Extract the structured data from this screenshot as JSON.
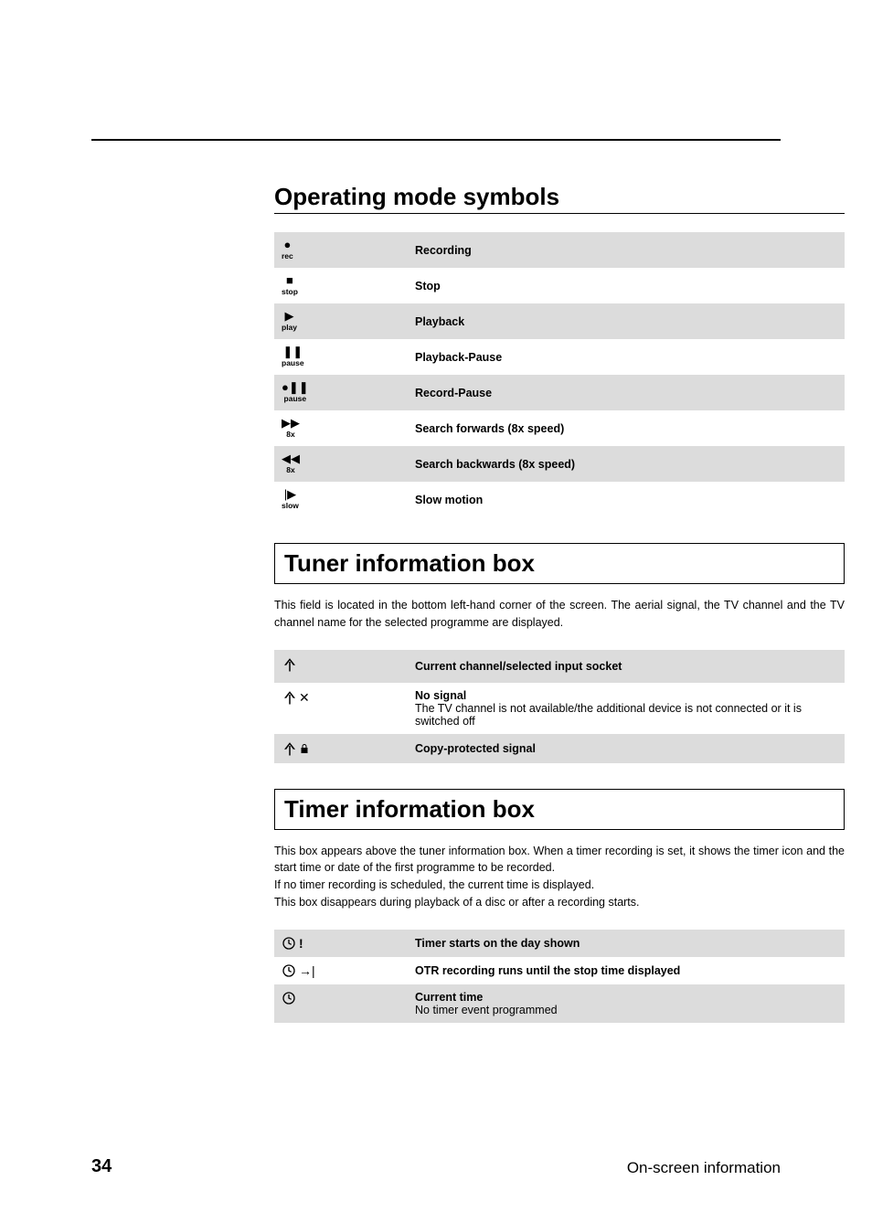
{
  "section1": {
    "heading": "Operating mode symbols",
    "rows": [
      {
        "glyph": "●",
        "label": "rec",
        "text": "Recording"
      },
      {
        "glyph": "■",
        "label": "stop",
        "text": "Stop"
      },
      {
        "glyph": "▶",
        "label": "play",
        "text": "Playback"
      },
      {
        "glyph": "❚❚",
        "label": "pause",
        "text": "Playback-Pause"
      },
      {
        "glyph": "●❚❚",
        "label": "pause",
        "text": "Record-Pause"
      },
      {
        "glyph": "▶▶",
        "label": "8x",
        "text": "Search forwards (8x speed)"
      },
      {
        "glyph": "◀◀",
        "label": "8x",
        "text": "Search backwards (8x speed)"
      },
      {
        "glyph": "|▶",
        "label": "slow",
        "text": "Slow motion"
      }
    ]
  },
  "section2": {
    "heading": "Tuner information box",
    "intro": "This field is located in the bottom left-hand corner of the screen. The aerial signal, the TV channel and the TV channel name for the selected programme are displayed.",
    "rows": [
      {
        "title": "Current channel/selected input socket",
        "sub": ""
      },
      {
        "title": "No signal",
        "sub": "The TV channel is not available/the additional device is not connected or it is switched off"
      },
      {
        "title": "Copy-protected signal",
        "sub": ""
      }
    ]
  },
  "section3": {
    "heading": "Timer information box",
    "intro1": "This box appears above the tuner information box. When a timer recording is set, it shows the timer icon and the start time or date of the first programme to be recorded.",
    "intro2": "If no timer recording is scheduled, the current time is displayed.",
    "intro3": "This box disappears during playback of a disc or after a recording starts.",
    "rows": [
      {
        "title": "Timer starts on the day shown",
        "sub": ""
      },
      {
        "title": "OTR recording runs until the stop time displayed",
        "sub": ""
      },
      {
        "title": "Current time",
        "sub": "No timer event programmed"
      }
    ]
  },
  "footer": {
    "page": "34",
    "title": "On-screen information"
  }
}
